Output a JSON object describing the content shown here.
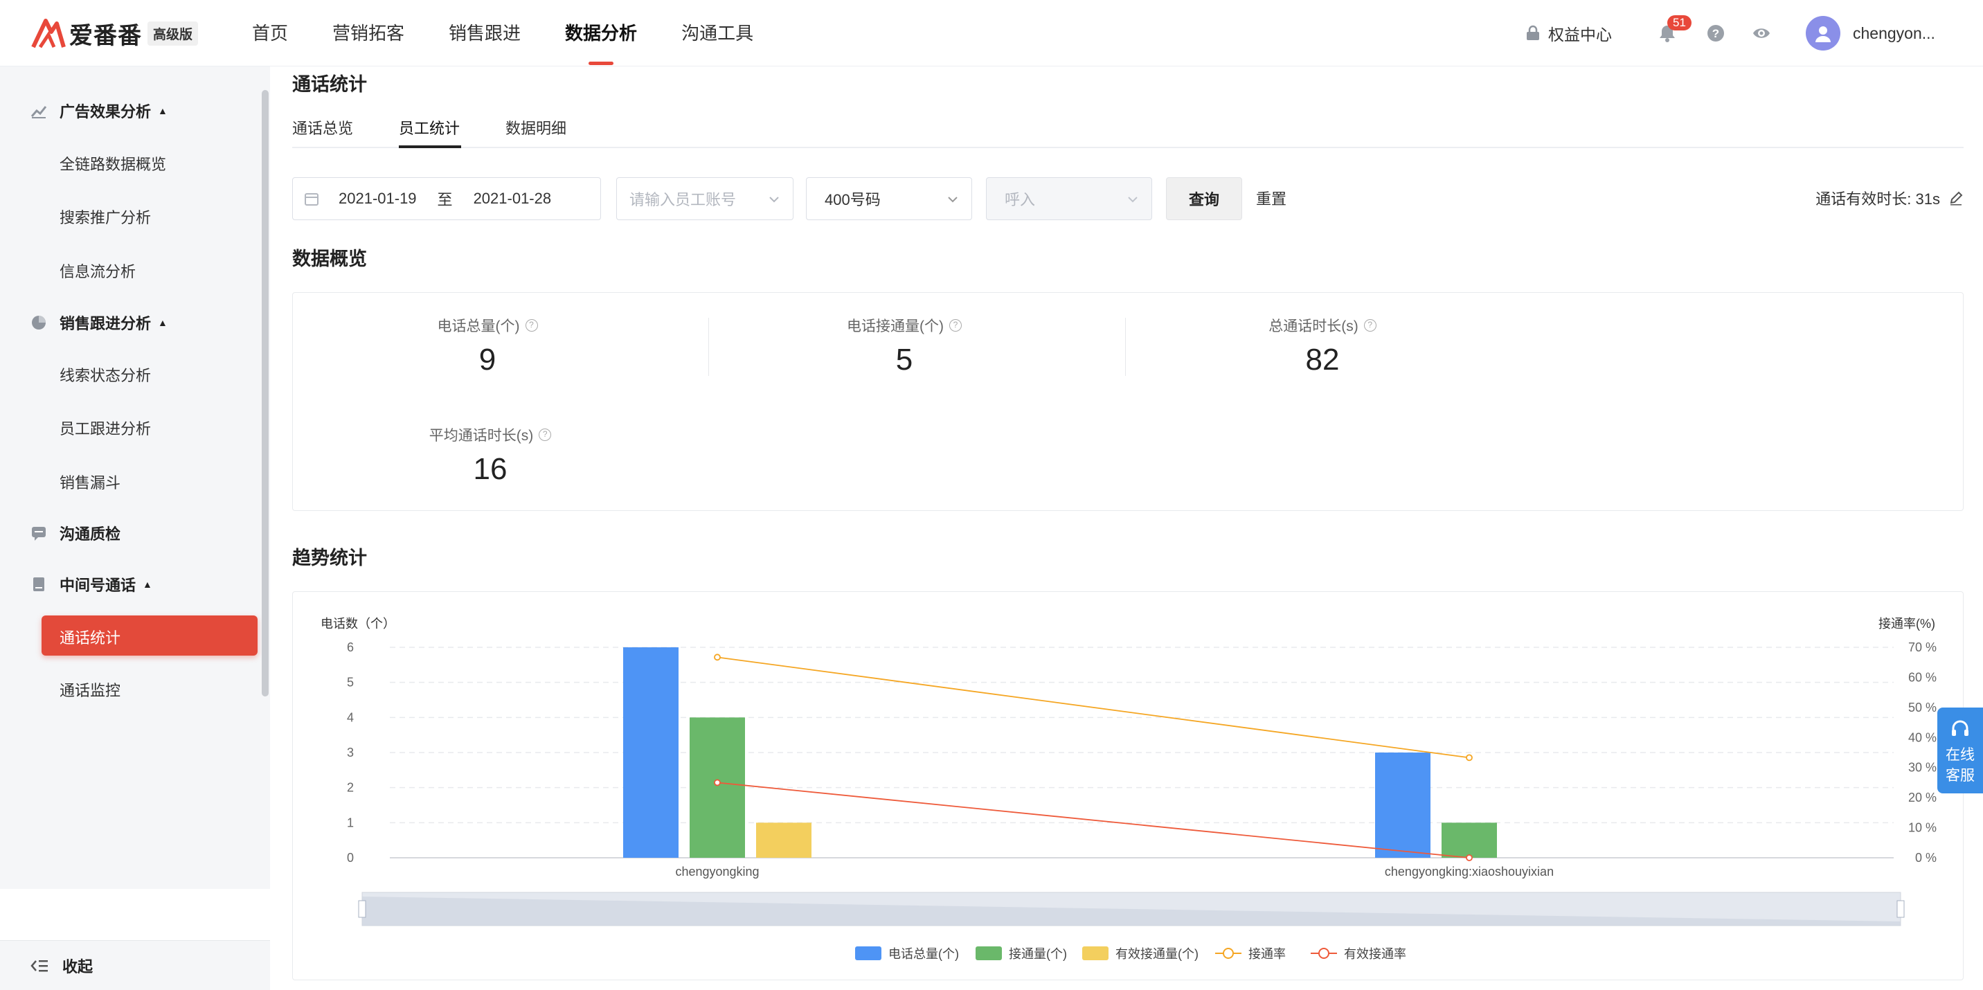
{
  "brand": {
    "name": "爱番番",
    "edition": "高级版"
  },
  "nav": {
    "items": [
      "首页",
      "营销拓客",
      "销售跟进",
      "数据分析",
      "沟通工具"
    ],
    "active_index": 3
  },
  "header": {
    "rights": "权益中心",
    "notification_count": "51",
    "username": "chengyon..."
  },
  "sidebar": {
    "groups": [
      {
        "label": "广告效果分析",
        "items": [
          "全链路数据概览",
          "搜索推广分析",
          "信息流分析"
        ]
      },
      {
        "label": "销售跟进分析",
        "items": [
          "线索状态分析",
          "员工跟进分析",
          "销售漏斗"
        ]
      },
      {
        "label": "沟通质检",
        "items": []
      },
      {
        "label": "中间号通话",
        "items": [
          "通话统计",
          "通话监控"
        ]
      }
    ],
    "active_item": "通话统计",
    "collapse_label": "收起"
  },
  "page": {
    "title": "通话统计",
    "tabs": [
      "通话总览",
      "员工统计",
      "数据明细"
    ],
    "active_tab": 1
  },
  "filters": {
    "date_start": "2021-01-19",
    "date_sep": "至",
    "date_end": "2021-01-28",
    "employee_placeholder": "请输入员工账号",
    "number_type": "400号码",
    "direction_placeholder": "呼入",
    "query_label": "查询",
    "reset_label": "重置",
    "effective_duration": "通话有效时长: 31s"
  },
  "overview": {
    "title": "数据概览",
    "metrics": [
      {
        "label": "电话总量(个)",
        "value": "9"
      },
      {
        "label": "电话接通量(个)",
        "value": "5"
      },
      {
        "label": "总通话时长(s)",
        "value": "82"
      },
      {
        "label": "平均通话时长(s)",
        "value": "16"
      }
    ]
  },
  "trend": {
    "title": "趋势统计"
  },
  "chart_data": {
    "type": "bar",
    "categories": [
      "chengyongking",
      "chengyongking:xiaoshouyixian"
    ],
    "ylabel": "电话数（个）",
    "ylabel_right": "接通率(%)",
    "ylim": [
      0,
      6
    ],
    "yticks": [
      "0",
      "1",
      "2",
      "3",
      "4",
      "5",
      "6"
    ],
    "ylim_right": [
      0,
      70
    ],
    "yticks_right": [
      "0 %",
      "10 %",
      "20 %",
      "30 %",
      "40 %",
      "50 %",
      "60 %",
      "70 %"
    ],
    "series": [
      {
        "name": "电话总量(个)",
        "type": "bar",
        "color": "#4e94f5",
        "values": [
          6,
          3
        ]
      },
      {
        "name": "接通量(个)",
        "type": "bar",
        "color": "#6ab86a",
        "values": [
          4,
          1
        ]
      },
      {
        "name": "有效接通量(个)",
        "type": "bar",
        "color": "#f3cf5e",
        "values": [
          1,
          0
        ]
      },
      {
        "name": "接通率",
        "type": "line",
        "axis": "right",
        "color": "#f5a623",
        "values": [
          66.7,
          33.3
        ]
      },
      {
        "name": "有效接通率",
        "type": "line",
        "axis": "right",
        "color": "#ee5a3a",
        "values": [
          25,
          0
        ]
      }
    ],
    "grid": true,
    "legend": "bottom"
  },
  "float_service": {
    "line1": "在线",
    "line2": "客服"
  }
}
